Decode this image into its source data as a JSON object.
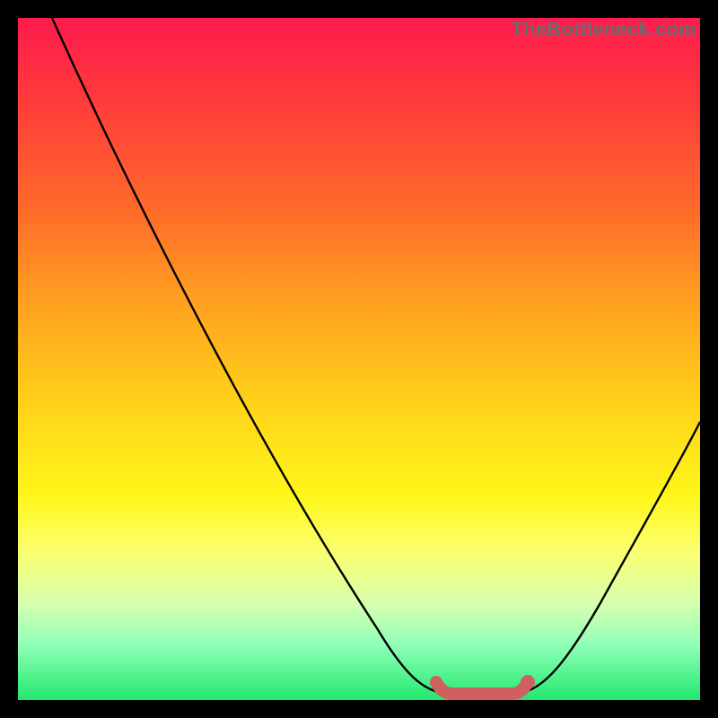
{
  "watermark": "TheBottleneck.com",
  "chart_data": {
    "type": "line",
    "title": "",
    "xlabel": "",
    "ylabel": "",
    "xlim": [
      0,
      100
    ],
    "ylim": [
      0,
      100
    ],
    "series": [
      {
        "name": "bottleneck-curve",
        "x": [
          5,
          10,
          15,
          20,
          25,
          30,
          35,
          40,
          45,
          50,
          55,
          60,
          62,
          66,
          72,
          75,
          80,
          85,
          90,
          95,
          100
        ],
        "y": [
          100,
          92,
          84,
          76,
          68,
          60,
          52,
          44,
          36,
          28,
          20,
          10,
          3,
          0,
          0,
          2,
          8,
          16,
          24,
          32,
          40
        ]
      }
    ],
    "highlight": {
      "name": "flat-bottom",
      "x": [
        62,
        64,
        66,
        68,
        70,
        72,
        74
      ],
      "y": [
        2,
        0.5,
        0,
        0,
        0,
        0.5,
        2
      ]
    },
    "gradient_stops": [
      {
        "pos": 0,
        "color": "#ff1a4d"
      },
      {
        "pos": 12,
        "color": "#ff3b3b"
      },
      {
        "pos": 28,
        "color": "#ff6a2a"
      },
      {
        "pos": 42,
        "color": "#ffa220"
      },
      {
        "pos": 58,
        "color": "#ffd61a"
      },
      {
        "pos": 70,
        "color": "#fff61a"
      },
      {
        "pos": 78,
        "color": "#fbff6e"
      },
      {
        "pos": 86,
        "color": "#d6ffb0"
      },
      {
        "pos": 92,
        "color": "#8fffb8"
      },
      {
        "pos": 100,
        "color": "#22e86f"
      }
    ]
  }
}
